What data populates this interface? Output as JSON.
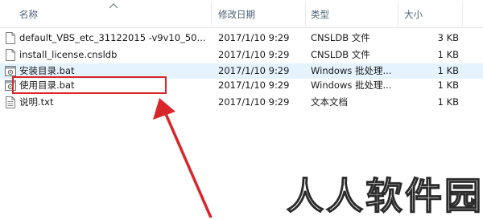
{
  "columns": {
    "name": "名称",
    "date": "修改日期",
    "type": "类型",
    "size": "大小"
  },
  "files": [
    {
      "name": "default_VBS_etc_31122015 -v9v10_50...",
      "date": "2017/1/10 9:29",
      "type": "CNSLDB 文件",
      "size": "3 KB",
      "icon": "blank-file-icon",
      "selected": false
    },
    {
      "name": "install_license.cnsldb",
      "date": "2017/1/10 9:29",
      "type": "CNSLDB 文件",
      "size": "1 KB",
      "icon": "blank-file-icon",
      "selected": false
    },
    {
      "name": "安装目录.bat",
      "date": "2017/1/10 9:29",
      "type": "Windows 批处理...",
      "size": "1 KB",
      "icon": "batch-file-icon",
      "selected": true
    },
    {
      "name": "使用目录.bat",
      "date": "2017/1/10 9:29",
      "type": "Windows 批处理...",
      "size": "1 KB",
      "icon": "batch-file-icon",
      "selected": false
    },
    {
      "name": "说明.txt",
      "date": "2017/1/10 9:29",
      "type": "文本文档",
      "size": "1 KB",
      "icon": "text-file-icon",
      "selected": false
    }
  ],
  "annotation": {
    "highlight_color": "#d9262b",
    "target_file": "使用目录.bat"
  },
  "watermark": "人人软件园",
  "colors": {
    "header_text": "#4c607a",
    "selected_row": "#e5f3ff"
  }
}
